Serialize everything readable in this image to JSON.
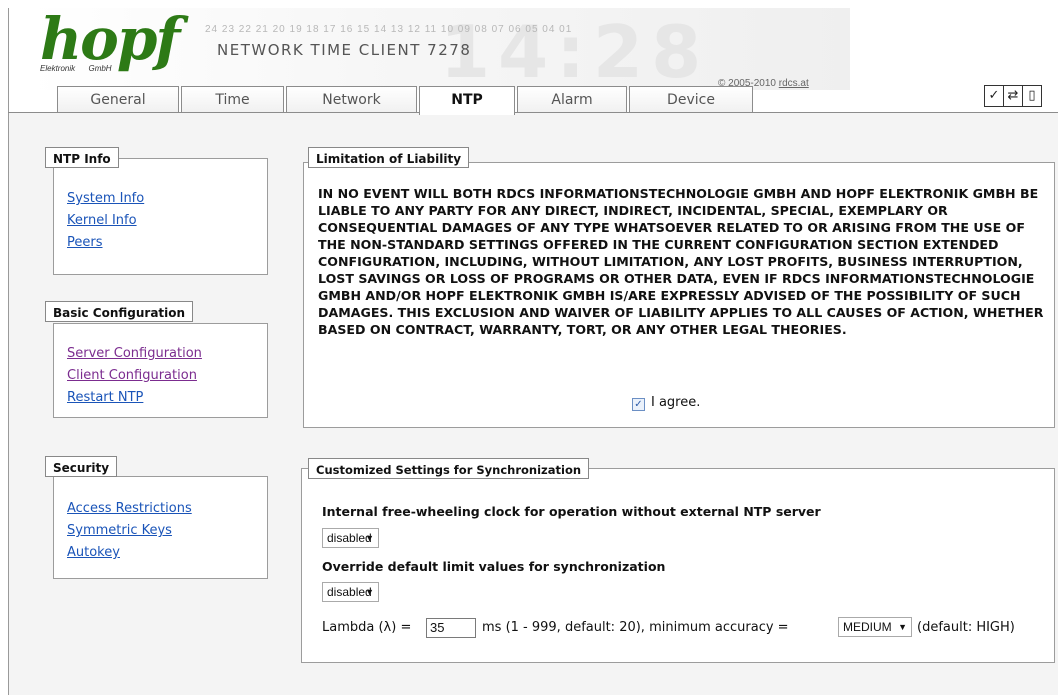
{
  "brand": {
    "logo_word": "hopf",
    "logo_sub_left": "Elektronik",
    "logo_sub_right": "GmbH",
    "product": "NETWORK TIME CLIENT 7278",
    "ruler": "24 23 22 21 20 19 18 17 16 15 14 13 12 11 10 09 08 07 06 05 04 01",
    "background_digits": "14:28",
    "copyright_prefix": "© 2005-2010 ",
    "copyright_link": "rdcs.at"
  },
  "tabs": [
    {
      "label": "General"
    },
    {
      "label": "Time"
    },
    {
      "label": "Network"
    },
    {
      "label": "NTP"
    },
    {
      "label": "Alarm"
    },
    {
      "label": "Device"
    }
  ],
  "active_tab": "NTP",
  "toolbar": {
    "apply_icon": "checkmark-icon",
    "reload_icon": "reload-icon",
    "save_icon": "save-icon"
  },
  "sidebar": {
    "ntp_info": {
      "title": "NTP Info",
      "links": [
        "System Info",
        "Kernel Info",
        "Peers"
      ]
    },
    "basic_configuration": {
      "title": "Basic Configuration",
      "links": [
        "Server Configuration",
        "Client Configuration",
        "Restart NTP"
      ]
    },
    "security": {
      "title": "Security",
      "links": [
        "Access Restrictions",
        "Symmetric Keys",
        "Autokey"
      ]
    }
  },
  "liability": {
    "title": "Limitation of Liability",
    "text": "IN NO EVENT WILL BOTH RDCS INFORMATIONSTECHNOLOGIE GMBH AND HOPF ELEKTRONIK GMBH BE LIABLE TO ANY PARTY FOR ANY DIRECT, INDIRECT, INCIDENTAL, SPECIAL, EXEMPLARY OR CONSEQUENTIAL DAMAGES OF ANY TYPE WHATSOEVER RELATED TO OR ARISING FROM THE USE OF THE NON-STANDARD SETTINGS OFFERED IN THE CURRENT CONFIGURATION SECTION EXTENDED CONFIGURATION, INCLUDING, WITHOUT LIMITATION, ANY LOST PROFITS, BUSINESS INTERRUPTION, LOST SAVINGS OR LOSS OF PROGRAMS OR OTHER DATA, EVEN IF RDCS INFORMATIONSTECHNOLOGIE GMBH AND/OR HOPF ELEKTRONIK GMBH IS/ARE EXPRESSLY ADVISED OF THE POSSIBILITY OF SUCH DAMAGES. THIS EXCLUSION AND WAIVER OF LIABILITY APPLIES TO ALL CAUSES OF ACTION, WHETHER BASED ON CONTRACT, WARRANTY, TORT, OR ANY OTHER LEGAL THEORIES.",
    "agree_label": "I agree.",
    "agree_checked": true
  },
  "sync_settings": {
    "title": "Customized Settings for Synchronization",
    "freewheel_label": "Internal free-wheeling clock for operation without external NTP server",
    "freewheel_value": "disabled",
    "override_label": "Override default limit values for synchronization",
    "override_value": "disabled",
    "lambda_prefix": "Lambda (λ) =",
    "lambda_value": "35",
    "lambda_suffix": "ms (1 - 999, default: 20), minimum accuracy =",
    "accuracy_value": "MEDIUM",
    "accuracy_suffix": "(default: HIGH)"
  }
}
